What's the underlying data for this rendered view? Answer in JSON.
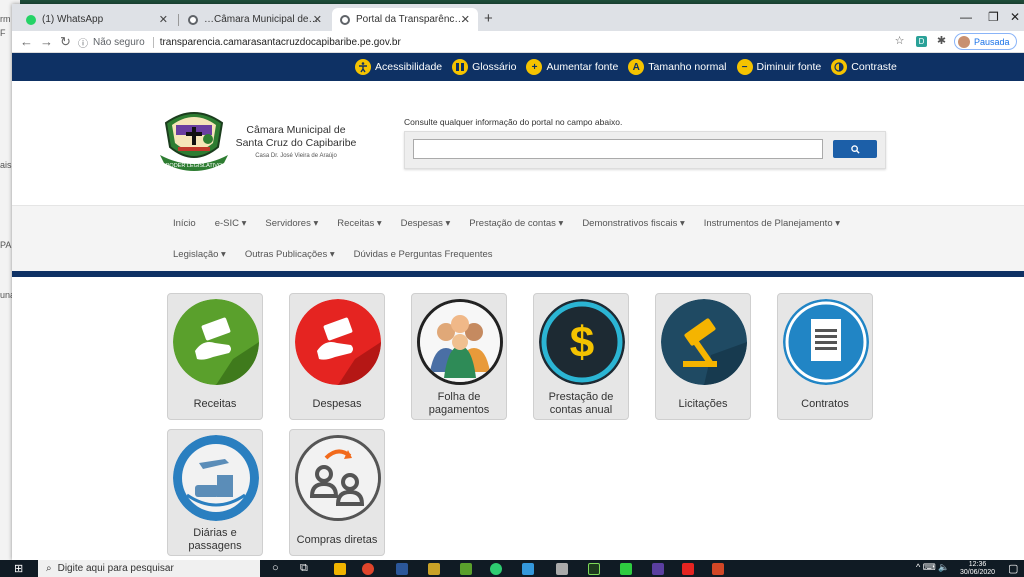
{
  "browser": {
    "tabs": [
      {
        "label": "(1) WhatsApp",
        "favicon_color": "#25d366"
      },
      {
        "label": "…Câmara Municipal de Vereado",
        "favicon_color": "#5f6368"
      },
      {
        "label": "Portal da Transparência - Câmara",
        "favicon_color": "#5f6368"
      }
    ],
    "url_security": "Não seguro",
    "url": "transparencia.camarasantacruzdocapibaribe.pe.gov.br",
    "profile_label": "Pausada"
  },
  "accessibility": [
    {
      "label": "Acessibilidade",
      "icon": "accessibility-icon"
    },
    {
      "label": "Glossário",
      "icon": "book-icon"
    },
    {
      "label": "Aumentar fonte",
      "icon": "plus-icon",
      "glyph": "+"
    },
    {
      "label": "Tamanho normal",
      "icon": "letter-a-icon",
      "glyph": "A"
    },
    {
      "label": "Diminuir fonte",
      "icon": "minus-icon",
      "glyph": "−"
    },
    {
      "label": "Contraste",
      "icon": "contrast-icon"
    }
  ],
  "header": {
    "name_line1": "Câmara Municipal de",
    "name_line2": "Santa Cruz do Capibaribe",
    "subtitle": "Casa Dr. José Vieira de Araújo",
    "logo_banner": "PODER LEGISLATIVO"
  },
  "search": {
    "hint": "Consulte qualquer informação do portal no campo abaixo.",
    "placeholder": ""
  },
  "nav": {
    "row1": [
      "Início",
      "e-SIC ▾",
      "Servidores ▾",
      "Receitas ▾",
      "Despesas ▾",
      "Prestação de contas ▾",
      "Demonstrativos fiscais ▾",
      "Instrumentos de Planejamento ▾"
    ],
    "row2": [
      "Legislação ▾",
      "Outras Publicações ▾",
      "Dúvidas e Perguntas Frequentes"
    ]
  },
  "tiles": [
    {
      "label": "Receitas",
      "icon": "money-hand-icon",
      "color": "#5aa02c"
    },
    {
      "label": "Despesas",
      "icon": "money-hand-icon",
      "color": "#e52421"
    },
    {
      "label": "Folha de\npagamentos",
      "icon": "people-group-icon",
      "color": "#f2f2f2"
    },
    {
      "label": "Prestação de\ncontas anual",
      "icon": "dollar-icon",
      "color": "#1d2a33"
    },
    {
      "label": "Licitações",
      "icon": "gavel-icon",
      "color": "#1f4a63"
    },
    {
      "label": "Contratos",
      "icon": "document-icon",
      "color": "#2185c5"
    },
    {
      "label": "Diárias e\npassagens",
      "icon": "travel-icon",
      "color": "#2a7fc0"
    },
    {
      "label": "Compras diretas",
      "icon": "transfer-people-icon",
      "color": "#f2f2f2"
    }
  ],
  "taskbar": {
    "search_placeholder": "Digite aqui para pesquisar",
    "time": "12:36",
    "date": "30/06/2020"
  },
  "colors": {
    "navy": "#0e3164",
    "accent_yellow": "#f5c300",
    "search_button": "#1c5fa8"
  }
}
